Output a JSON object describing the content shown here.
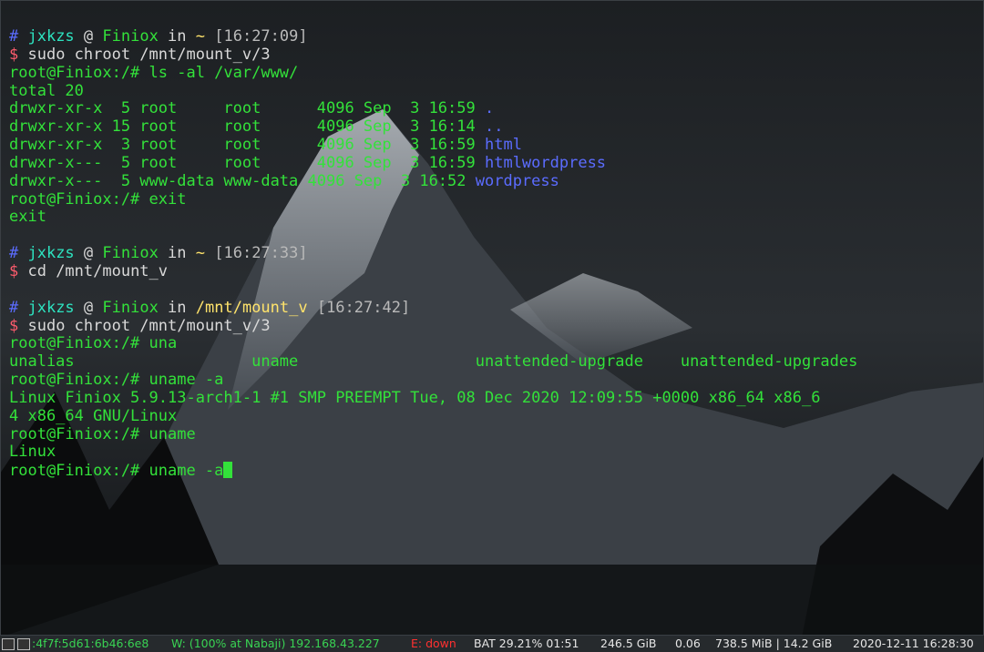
{
  "terminal": {
    "lines": [
      [
        {
          "t": "# ",
          "c": "hash"
        },
        {
          "t": "jxkzs",
          "c": "c"
        },
        {
          "t": " @ ",
          "c": "w"
        },
        {
          "t": "Finiox",
          "c": "g"
        },
        {
          "t": " in ",
          "c": "w"
        },
        {
          "t": "~",
          "c": "y"
        },
        {
          "t": " [16:27:09]",
          "c": "gr"
        }
      ],
      [
        {
          "t": "$ ",
          "c": "pk"
        },
        {
          "t": "sudo chroot /mnt/mount_v/3",
          "c": "w"
        }
      ],
      [
        {
          "t": "root@Finiox:/# ls -al /var/www/",
          "c": "g"
        }
      ],
      [
        {
          "t": "total 20",
          "c": "g"
        }
      ],
      [
        {
          "t": "drwxr-xr-x  5 root     root      4096 Sep  3 16:59 ",
          "c": "g"
        },
        {
          "t": ".",
          "c": "b"
        }
      ],
      [
        {
          "t": "drwxr-xr-x 15 root     root      4096 Sep  3 16:14 ",
          "c": "g"
        },
        {
          "t": "..",
          "c": "b"
        }
      ],
      [
        {
          "t": "drwxr-xr-x  3 root     root      4096 Sep  3 16:59 ",
          "c": "g"
        },
        {
          "t": "html",
          "c": "b"
        }
      ],
      [
        {
          "t": "drwxr-x---  5 root     root      4096 Sep  3 16:59 ",
          "c": "g"
        },
        {
          "t": "htmlwordpress",
          "c": "b"
        }
      ],
      [
        {
          "t": "drwxr-x---  5 www-data www-data 4096 Sep  3 16:52 ",
          "c": "g"
        },
        {
          "t": "wordpress",
          "c": "b"
        }
      ],
      [
        {
          "t": "root@Finiox:/# exit",
          "c": "g"
        }
      ],
      [
        {
          "t": "exit",
          "c": "g"
        }
      ],
      [
        {
          "t": "",
          "c": "g"
        }
      ],
      [
        {
          "t": "# ",
          "c": "hash"
        },
        {
          "t": "jxkzs",
          "c": "c"
        },
        {
          "t": " @ ",
          "c": "w"
        },
        {
          "t": "Finiox",
          "c": "g"
        },
        {
          "t": " in ",
          "c": "w"
        },
        {
          "t": "~",
          "c": "y"
        },
        {
          "t": " [16:27:33]",
          "c": "gr"
        }
      ],
      [
        {
          "t": "$ ",
          "c": "pk"
        },
        {
          "t": "cd /mnt/mount_v",
          "c": "w"
        }
      ],
      [
        {
          "t": "",
          "c": "g"
        }
      ],
      [
        {
          "t": "# ",
          "c": "hash"
        },
        {
          "t": "jxkzs",
          "c": "c"
        },
        {
          "t": " @ ",
          "c": "w"
        },
        {
          "t": "Finiox",
          "c": "g"
        },
        {
          "t": " in ",
          "c": "w"
        },
        {
          "t": "/mnt/mount_v",
          "c": "y"
        },
        {
          "t": " [16:27:42]",
          "c": "gr"
        }
      ],
      [
        {
          "t": "$ ",
          "c": "pk"
        },
        {
          "t": "sudo chroot /mnt/mount_v/3",
          "c": "w"
        }
      ],
      [
        {
          "t": "root@Finiox:/# una",
          "c": "g"
        }
      ],
      [
        {
          "t": "unalias                   uname                   unattended-upgrade    unattended-upgrades",
          "c": "g"
        }
      ],
      [
        {
          "t": "root@Finiox:/# uname -a",
          "c": "g"
        }
      ],
      [
        {
          "t": "Linux Finiox 5.9.13-arch1-1 #1 SMP PREEMPT Tue, 08 Dec 2020 12:09:55 +0000 x86_64 x86_6",
          "c": "g"
        }
      ],
      [
        {
          "t": "4 x86_64 GNU/Linux",
          "c": "g"
        }
      ],
      [
        {
          "t": "root@Finiox:/# uname",
          "c": "g"
        }
      ],
      [
        {
          "t": "Linux",
          "c": "g"
        }
      ],
      [
        {
          "t": "root@Finiox:/# uname -a",
          "c": "g"
        }
      ]
    ]
  },
  "statusbar": {
    "ipv6": ":4f7f:5d61:6b46:6e8",
    "wifi": "W: (100% at Nabaji) 192.168.43.227",
    "ethernet": "E: down",
    "battery": "BAT 29.21% 01:51",
    "disk": "246.5 GiB",
    "load": "0.06",
    "memory": "738.5 MiB | 14.2 GiB",
    "datetime": "2020-12-11 16:28:30"
  },
  "colors": {
    "prompt_green": "#33e13a",
    "user_cyan": "#2de3c0",
    "dollar_pink": "#ff5c6d",
    "dir_blue": "#5b6cff",
    "path_yellow": "#ffe36b",
    "ethernet_down": "#ff3030",
    "wifi_green": "#39d353"
  }
}
